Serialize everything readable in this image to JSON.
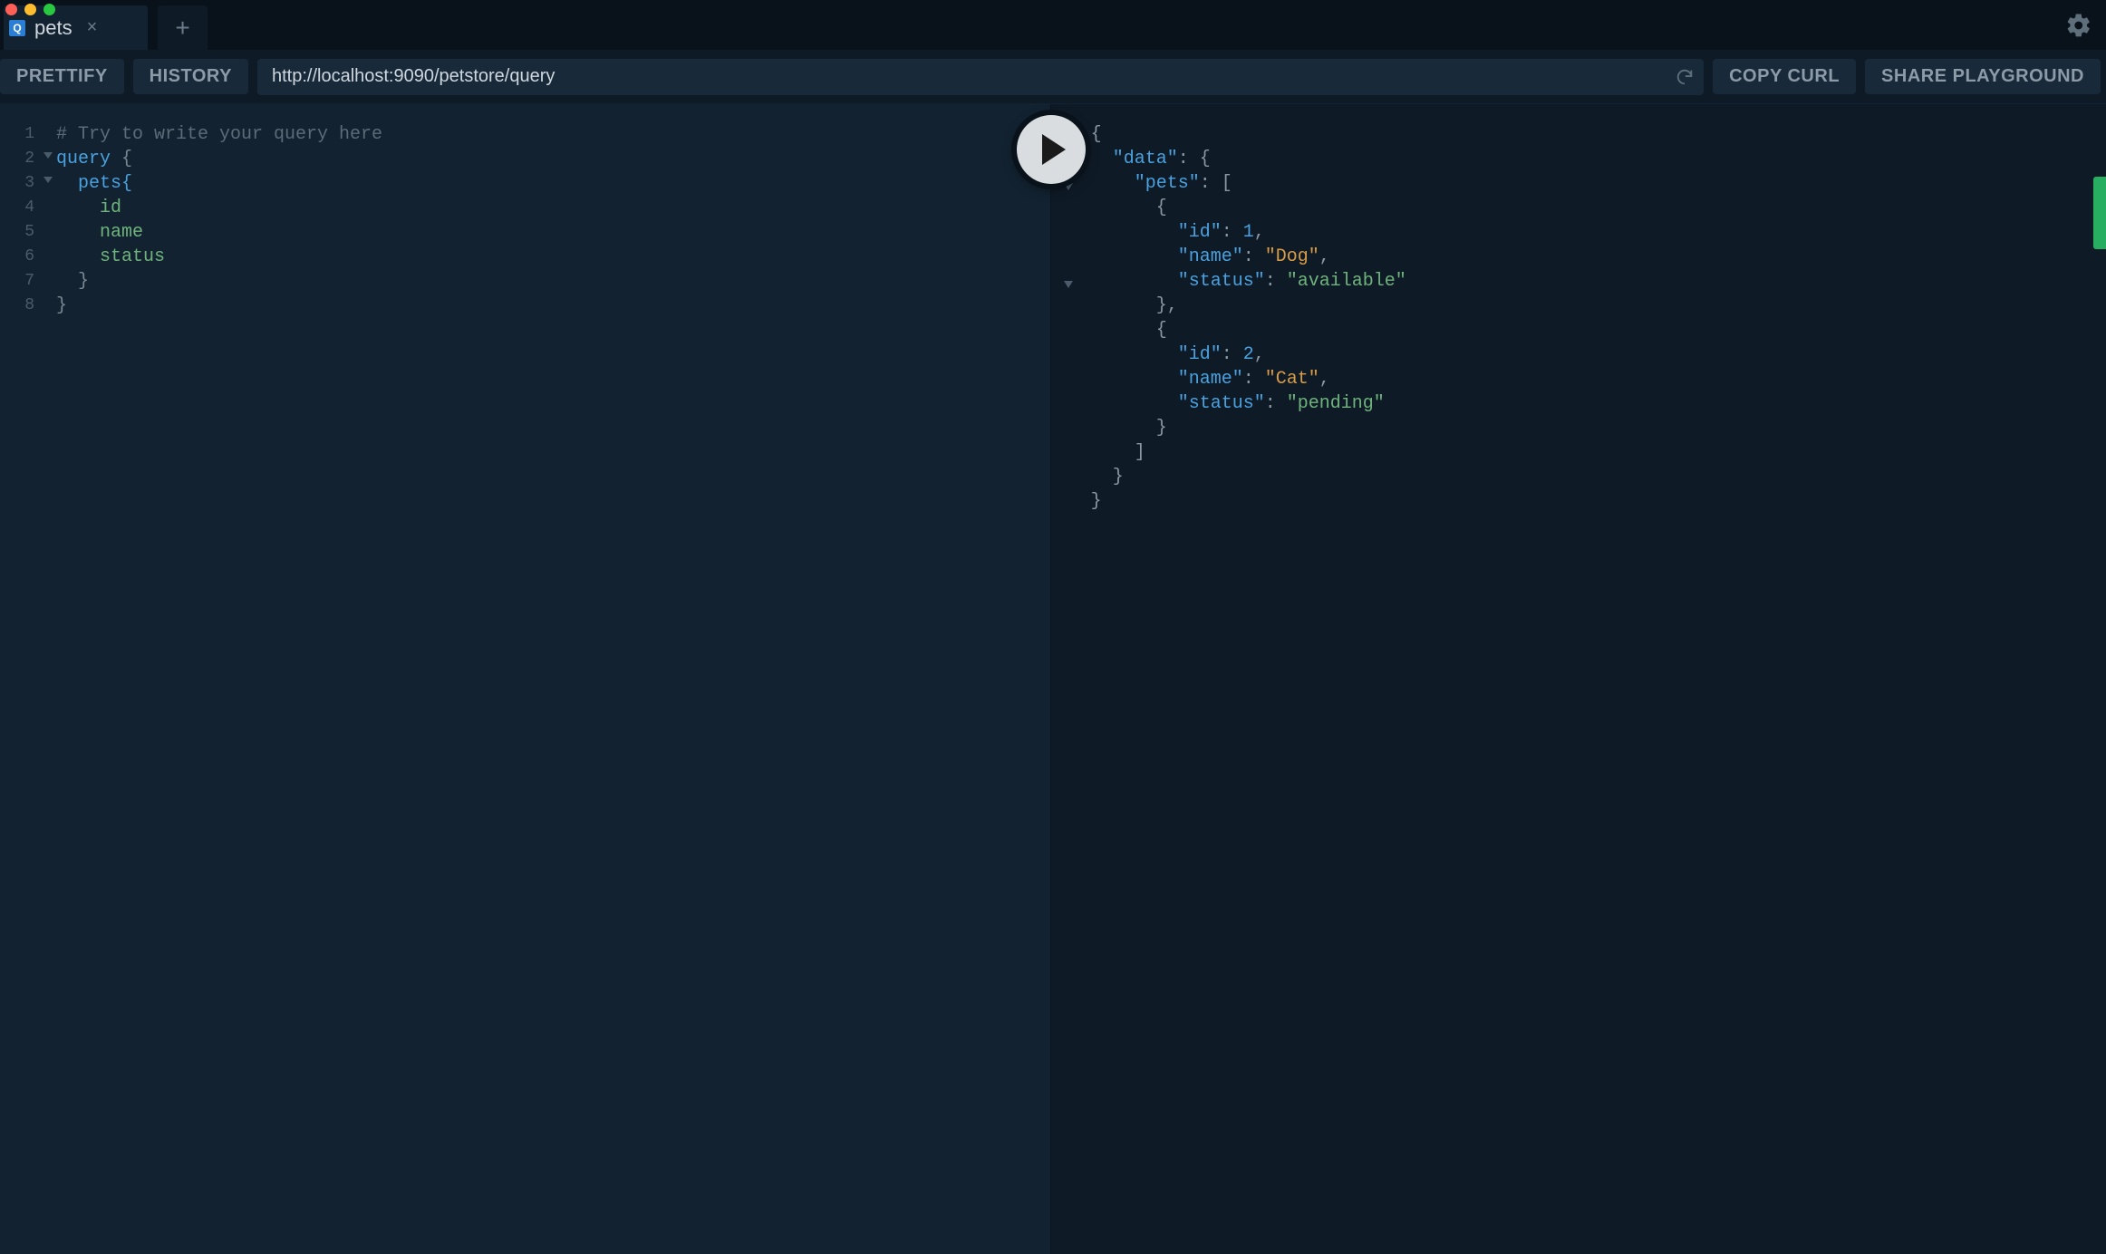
{
  "tabs": {
    "active": {
      "badge": "Q",
      "title": "pets"
    }
  },
  "toolbar": {
    "prettify": "PRETTIFY",
    "history": "HISTORY",
    "copy_curl": "COPY CURL",
    "share": "SHARE PLAYGROUND",
    "endpoint": "http://localhost:9090/petstore/query"
  },
  "editor": {
    "line_count": 8,
    "lines": {
      "l1_comment": "# Try to write your query here",
      "l2_kw": "query",
      "l2_rest": " {",
      "l3": "  pets{",
      "l4": "    id",
      "l5": "    name",
      "l6": "    status",
      "l7": "  }",
      "l8": "}"
    }
  },
  "result": {
    "data": {
      "pets": [
        {
          "id": 1,
          "name": "Dog",
          "status": "available"
        },
        {
          "id": 2,
          "name": "Cat",
          "status": "pending"
        }
      ]
    },
    "tokens": {
      "open_brace": "{",
      "close_brace": "}",
      "open_bracket": "[",
      "close_bracket": "]",
      "colon": ": ",
      "comma": ",",
      "q": "\"",
      "k_data": "\"data\"",
      "k_pets": "\"pets\"",
      "k_id": "\"id\"",
      "k_name": "\"name\"",
      "k_status": "\"status\"",
      "v_dog": "\"Dog\"",
      "v_cat": "\"Cat\"",
      "v_avail": "\"available\"",
      "v_pend": "\"pending\"",
      "v_1": "1",
      "v_2": "2"
    }
  }
}
